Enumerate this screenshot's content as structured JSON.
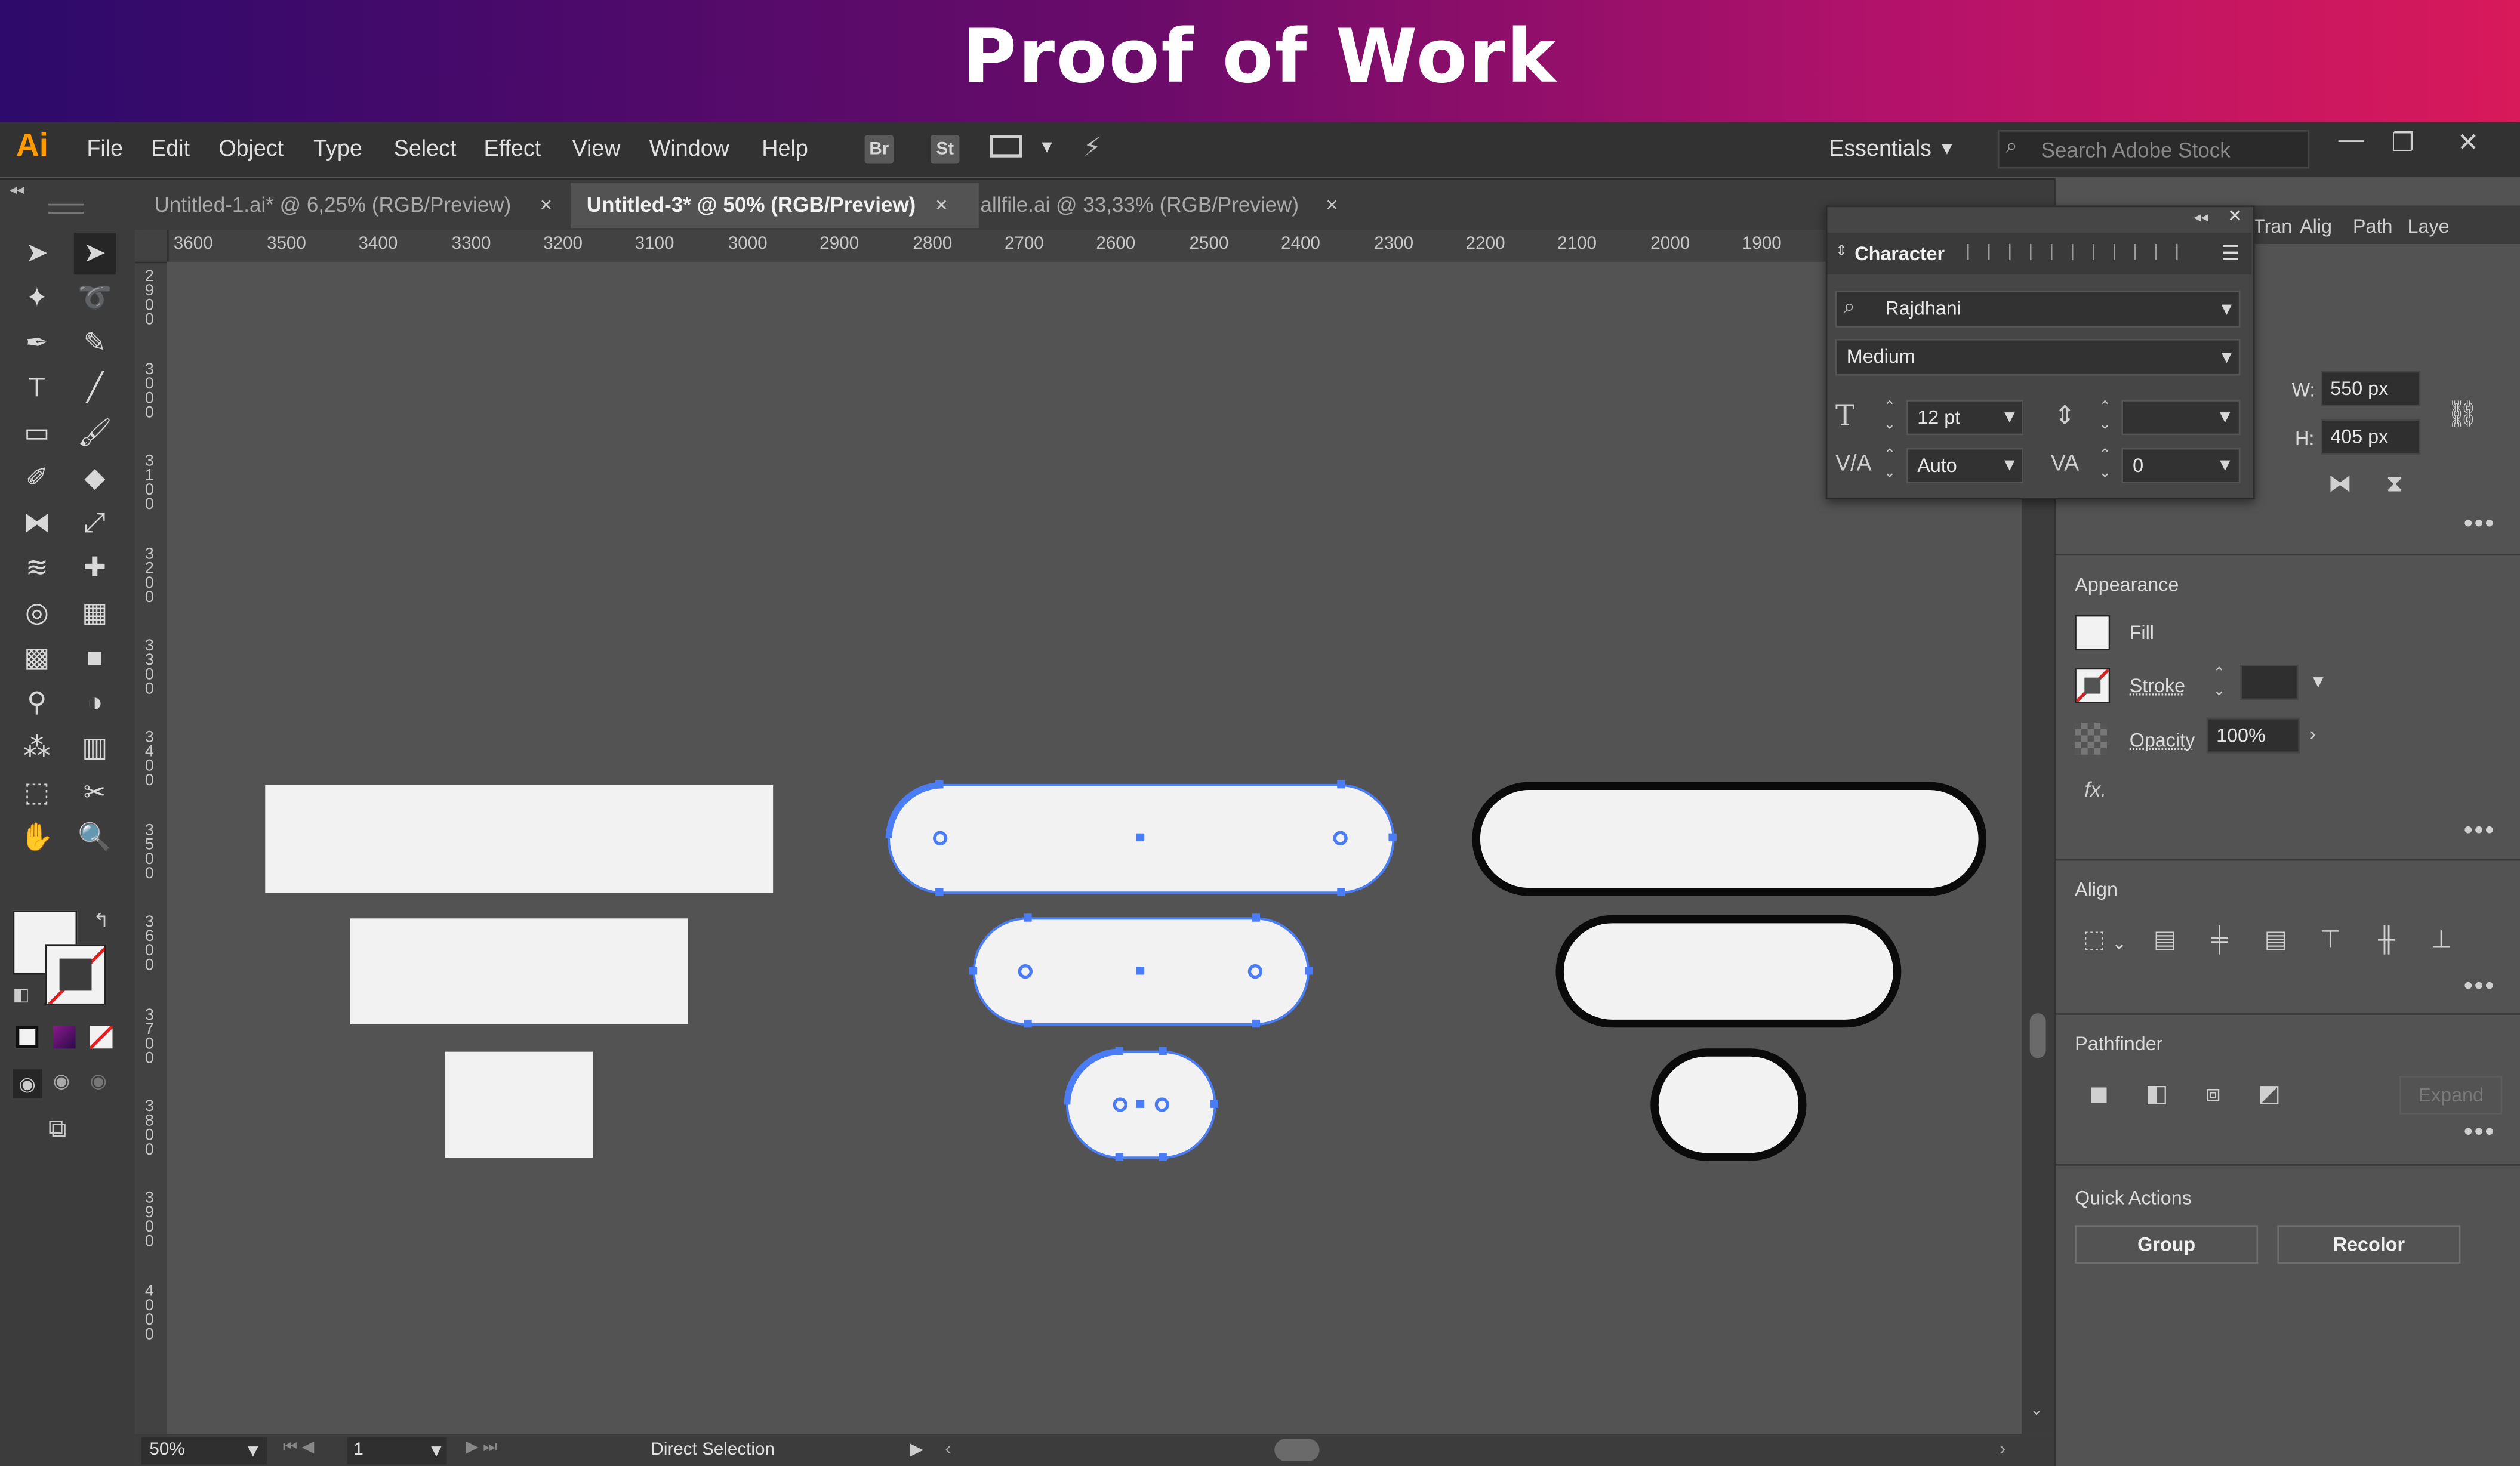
{
  "banner": {
    "title": "Proof of Work"
  },
  "app": {
    "logo": "Ai"
  },
  "menu": [
    "File",
    "Edit",
    "Object",
    "Type",
    "Select",
    "Effect",
    "View",
    "Window",
    "Help"
  ],
  "bridge": {
    "br": "Br",
    "st": "St"
  },
  "workspace": {
    "label": "Essentials"
  },
  "search": {
    "placeholder": "Search Adobe Stock"
  },
  "tabs": [
    {
      "label": "Untitled-1.ai* @ 6,25% (RGB/Preview)",
      "active": false
    },
    {
      "label": "Untitled-3* @ 50% (RGB/Preview)",
      "active": true
    },
    {
      "label": "allfile.ai @ 33,33% (RGB/Preview)",
      "active": false
    }
  ],
  "tab_close": "×",
  "ruler": {
    "top": [
      "3600",
      "3500",
      "3400",
      "3300",
      "3200",
      "3100",
      "3000",
      "2900",
      "2800",
      "2700",
      "2600",
      "2500",
      "2400",
      "2300",
      "2200",
      "2100",
      "2000",
      "1900"
    ],
    "left": [
      "2900",
      "3000",
      "3100",
      "3200",
      "3300",
      "3400",
      "3500",
      "3600",
      "3700",
      "3800",
      "3900",
      "4000"
    ]
  },
  "character": {
    "title": "Character",
    "font_family": "Rajdhani",
    "font_style": "Medium",
    "font_size": "12 pt",
    "leading": "",
    "kerning": "Auto",
    "tracking": "0"
  },
  "right_tabs": [
    "Tran",
    "Alig",
    "Path",
    "Laye"
  ],
  "transform": {
    "w_label": "W:",
    "w_value": "550 px",
    "h_label": "H:",
    "h_value": "405 px"
  },
  "appearance": {
    "title": "Appearance",
    "fill": "Fill",
    "stroke": "Stroke",
    "opacity": "Opacity",
    "opacity_value": "100%",
    "fx": "fx."
  },
  "align": {
    "title": "Align"
  },
  "pathfinder": {
    "title": "Pathfinder",
    "expand": "Expand"
  },
  "quick_actions": {
    "title": "Quick Actions",
    "group": "Group",
    "recolor": "Recolor"
  },
  "status": {
    "zoom": "50%",
    "artboard": "1",
    "tool": "Direct Selection"
  },
  "colors": {
    "selection": "#4a7cf5",
    "shape_fill": "#f2f2f2",
    "stroke": "#0a0a0a",
    "accent": "#ff9a00"
  }
}
